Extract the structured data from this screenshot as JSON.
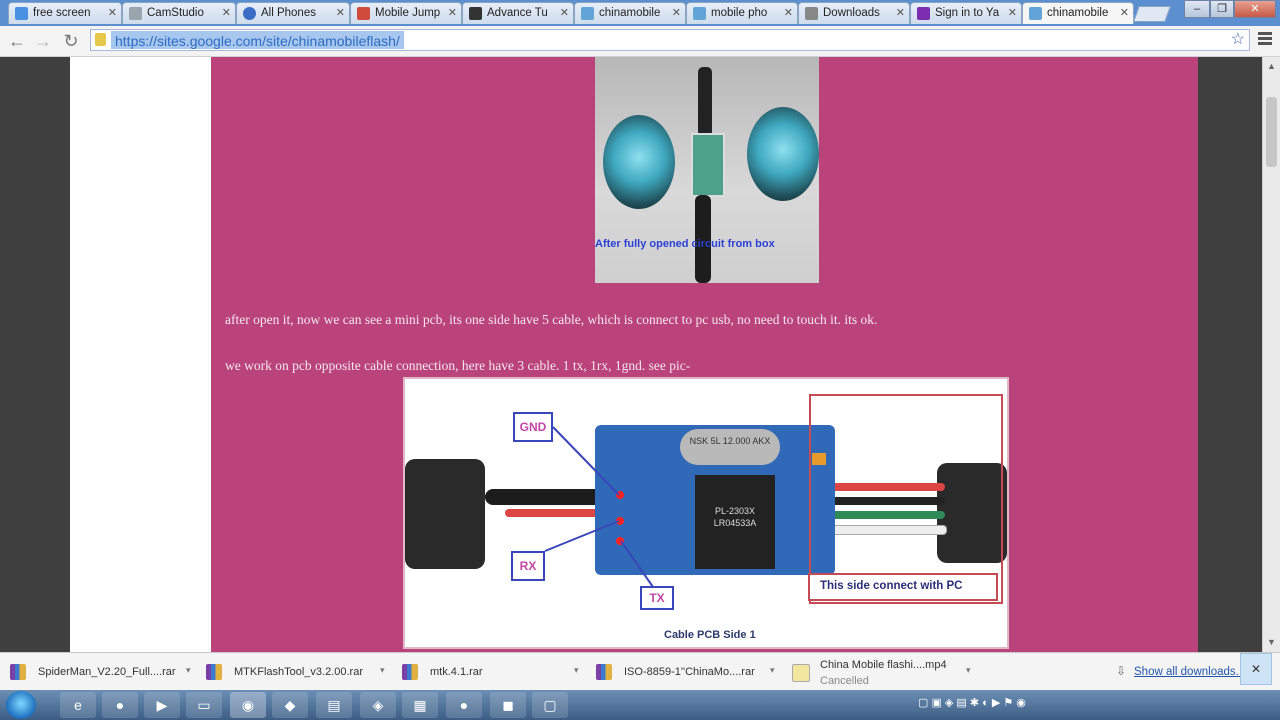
{
  "tabs": [
    {
      "title": "free screen",
      "favicon_color": "#4a90e2"
    },
    {
      "title": "CamStudio",
      "favicon_color": "#9aa4ad"
    },
    {
      "title": "All Phones",
      "favicon_color": "#3a6cc5"
    },
    {
      "title": "Mobile Jump",
      "favicon_color": "#d04b3b"
    },
    {
      "title": "Advance Tu",
      "favicon_color": "#333333"
    },
    {
      "title": "chinamobile",
      "favicon_color": "#63a4d8"
    },
    {
      "title": "mobile pho",
      "favicon_color": "#63a4d8"
    },
    {
      "title": "Downloads",
      "favicon_color": "#888888"
    },
    {
      "title": "Sign in to Ya",
      "favicon_color": "#7b2fb0"
    },
    {
      "title": "chinamobile",
      "favicon_color": "#63a4d8"
    }
  ],
  "url": "https://sites.google.com/site/chinamobileflash/",
  "page": {
    "photo_caption": "After fully opened circuit from box",
    "paragraph1": "after open it, now we can see a mini pcb, its one side have 5 cable, which is connect to pc usb, no need to touch it. its ok.",
    "paragraph2": "we work on pcb opposite cable connection, here have 3 cable. 1 tx, 1rx, 1gnd. see pic-",
    "pcb_labels": {
      "gnd": "GND",
      "rx": "RX",
      "tx": "TX"
    },
    "pc_side_label": "This side connect with PC",
    "chip_text": "NSK 5L 12.000 AKX",
    "ic_text": "PL-2303X LR04533A",
    "pcb_caption": "Cable PCB Side 1"
  },
  "downloads": [
    {
      "name": "SpiderMan_V2.20_Full....rar",
      "status": ""
    },
    {
      "name": "MTKFlashTool_v3.2.00.rar",
      "status": ""
    },
    {
      "name": "mtk.4.1.rar",
      "status": ""
    },
    {
      "name": "ISO-8859-1''ChinaMo....rar",
      "status": ""
    },
    {
      "name": "China Mobile flashi....mp4",
      "status": "Cancelled"
    }
  ],
  "show_all_downloads": "Show all downloads...",
  "colors": {
    "page_background": "#b9437a",
    "tab_strip": "#5b8fcf",
    "link": "#2255aa"
  }
}
